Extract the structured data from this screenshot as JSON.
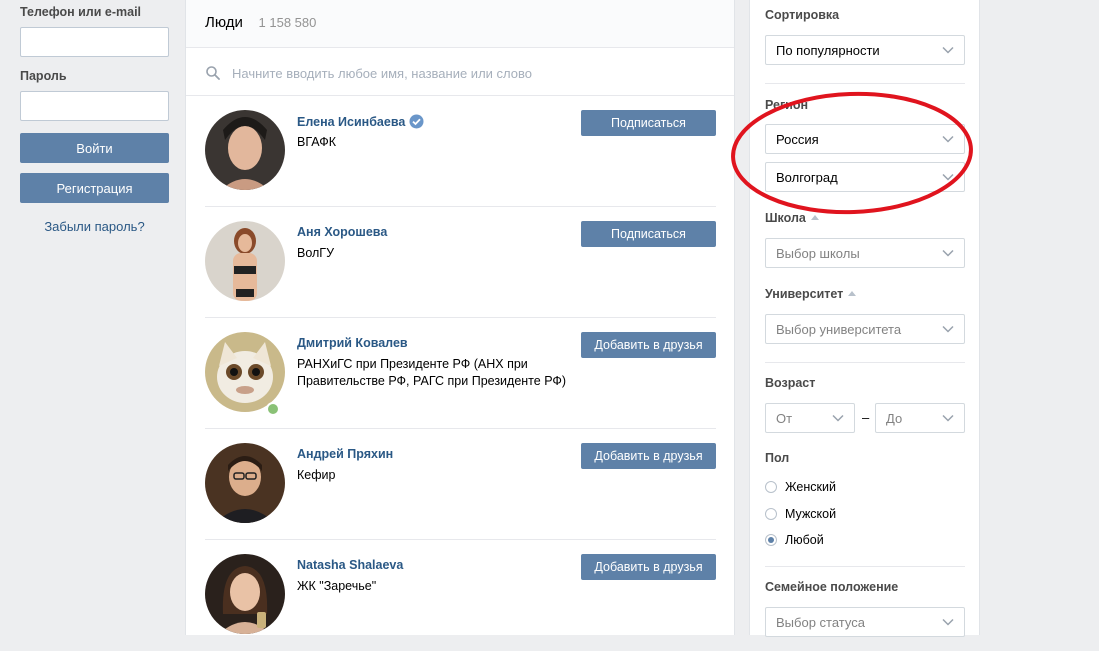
{
  "login": {
    "phone_label": "Телефон или e-mail",
    "password_label": "Пароль",
    "login_button": "Войти",
    "register_button": "Регистрация",
    "forgot_link": "Забыли пароль?"
  },
  "results": {
    "title": "Люди",
    "count": "1 158 580",
    "search_placeholder": "Начните вводить любое имя, название или слово",
    "people": [
      {
        "name": "Елена Исинбаева",
        "sub": "ВГАФК",
        "button": "Подписаться",
        "verified": true
      },
      {
        "name": "Аня Хорошева",
        "sub": "ВолГУ",
        "button": "Подписаться"
      },
      {
        "name": "Дмитрий Ковалев",
        "sub": "РАНХиГС при Президенте РФ (АНХ при Правительстве РФ, РАГС при Президенте РФ)",
        "button": "Добавить в друзья",
        "online": true
      },
      {
        "name": "Андрей Пряхин",
        "sub": "Кефир",
        "button": "Добавить в друзья"
      },
      {
        "name": "Natasha Shalaeva",
        "sub": "ЖК \"Заречье\"",
        "button": "Добавить в друзья"
      }
    ]
  },
  "filters": {
    "sort_label": "Сортировка",
    "sort_value": "По популярности",
    "region_label": "Регион",
    "country_value": "Россия",
    "city_value": "Волгоград",
    "school_label": "Школа",
    "school_placeholder": "Выбор школы",
    "university_label": "Университет",
    "university_placeholder": "Выбор университета",
    "age_label": "Возраст",
    "age_from": "От",
    "age_dash": "–",
    "age_to": "До",
    "sex_label": "Пол",
    "sex_options": [
      "Женский",
      "Мужской",
      "Любой"
    ],
    "sex_selected": "Любой",
    "marital_label": "Семейное положение",
    "marital_placeholder": "Выбор статуса"
  },
  "colors": {
    "accent": "#5e81a8",
    "link": "#2a5885",
    "annotation": "#e0141e",
    "online": "#8ac176"
  }
}
